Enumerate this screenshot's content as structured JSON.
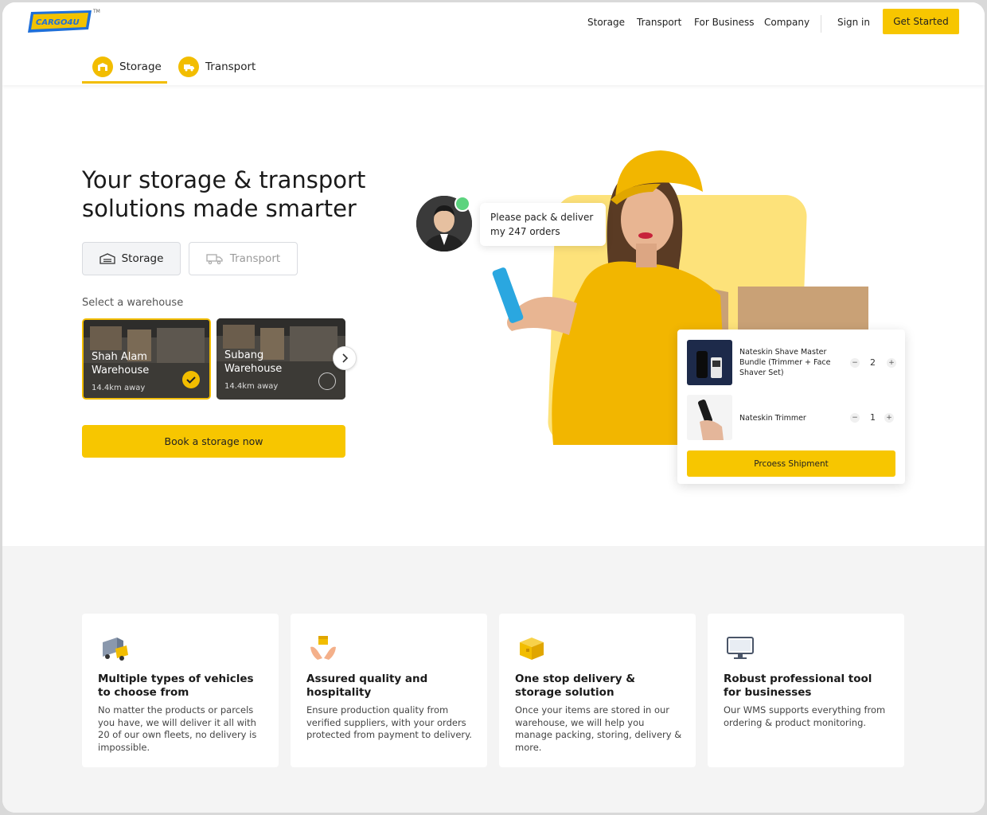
{
  "brand": {
    "logo_text": "CARGO4U",
    "tm": "TM"
  },
  "nav": {
    "links": [
      "Storage",
      "Transport",
      "For Business",
      "Company"
    ],
    "sign_in": "Sign in",
    "cta": "Get Started"
  },
  "subtabs": [
    {
      "label": "Storage",
      "icon": "warehouse-icon",
      "active": true
    },
    {
      "label": "Transport",
      "icon": "truck-icon",
      "active": false
    }
  ],
  "hero": {
    "title": "Your storage & transport solutions made smarter",
    "segments": [
      "Storage",
      "Transport"
    ],
    "select_label": "Select a warehouse",
    "warehouses": [
      {
        "name": "Shah Alam Warehouse",
        "distance": "14.4km away",
        "selected": true
      },
      {
        "name": "Subang Warehouse",
        "distance": "14.4km away",
        "selected": false
      }
    ],
    "book_button": "Book a storage now"
  },
  "illustration": {
    "chat_message": "Please pack & deliver my 247 orders",
    "order_items": [
      {
        "name": "Nateskin Shave Master Bundle (Trimmer + Face Shaver Set)",
        "qty": "2"
      },
      {
        "name": "Nateskin Trimmer",
        "qty": "1"
      }
    ],
    "qty_minus": "−",
    "qty_plus": "+",
    "process_button": "Prcoess Shipment"
  },
  "features": [
    {
      "icon": "delivery-truck-icon",
      "title": "Multiple types of vehicles to choose from",
      "text": "No matter the products or parcels you have, we will deliver it all with 20 of our own fleets, no delivery is impossible."
    },
    {
      "icon": "hands-box-icon",
      "title": "Assured quality and hospitality",
      "text": "Ensure production quality from verified suppliers, with your orders protected from payment to delivery."
    },
    {
      "icon": "package-box-icon",
      "title": "One stop delivery & storage solution",
      "text": "Once your items are stored in our warehouse, we will help you manage packing, storing, delivery & more."
    },
    {
      "icon": "monitor-icon",
      "title": "Robust professional tool for businesses",
      "text": "Our WMS supports everything from ordering & product monitoring."
    }
  ],
  "colors": {
    "accent": "#f7c600",
    "accent_dark": "#f2bd00",
    "online": "#5cd37e",
    "logo_blue": "#1e6fd9"
  }
}
